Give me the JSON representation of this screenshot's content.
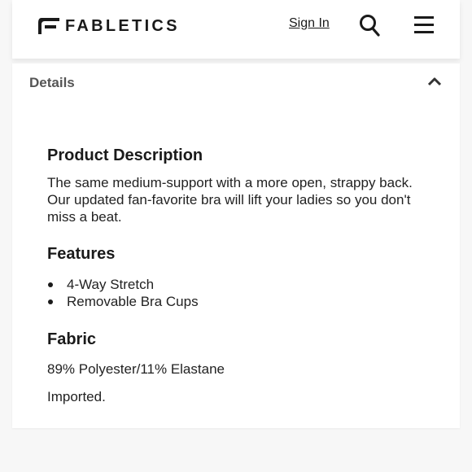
{
  "header": {
    "brand": "FABLETICS",
    "sign_in_label": "Sign In",
    "search_icon": "search-icon",
    "menu_icon": "hamburger-menu-icon"
  },
  "accordion": {
    "title": "Details",
    "state_icon": "chevron-up-icon"
  },
  "product_description": {
    "heading": "Product Description",
    "text": "The same medium-support with a more open, strappy back. Our updated fan-favorite bra will lift your ladies so you don't miss a beat."
  },
  "features": {
    "heading": "Features",
    "items": [
      "4-Way Stretch",
      "Removable Bra Cups"
    ]
  },
  "fabric": {
    "heading": "Fabric",
    "composition": "89% Polyester/11% Elastane",
    "origin": "Imported."
  },
  "colors": {
    "page_background": "#f7f7f7",
    "card_background": "#ffffff",
    "text_dark": "#1a1a1a",
    "accordion_title": "#555555"
  }
}
